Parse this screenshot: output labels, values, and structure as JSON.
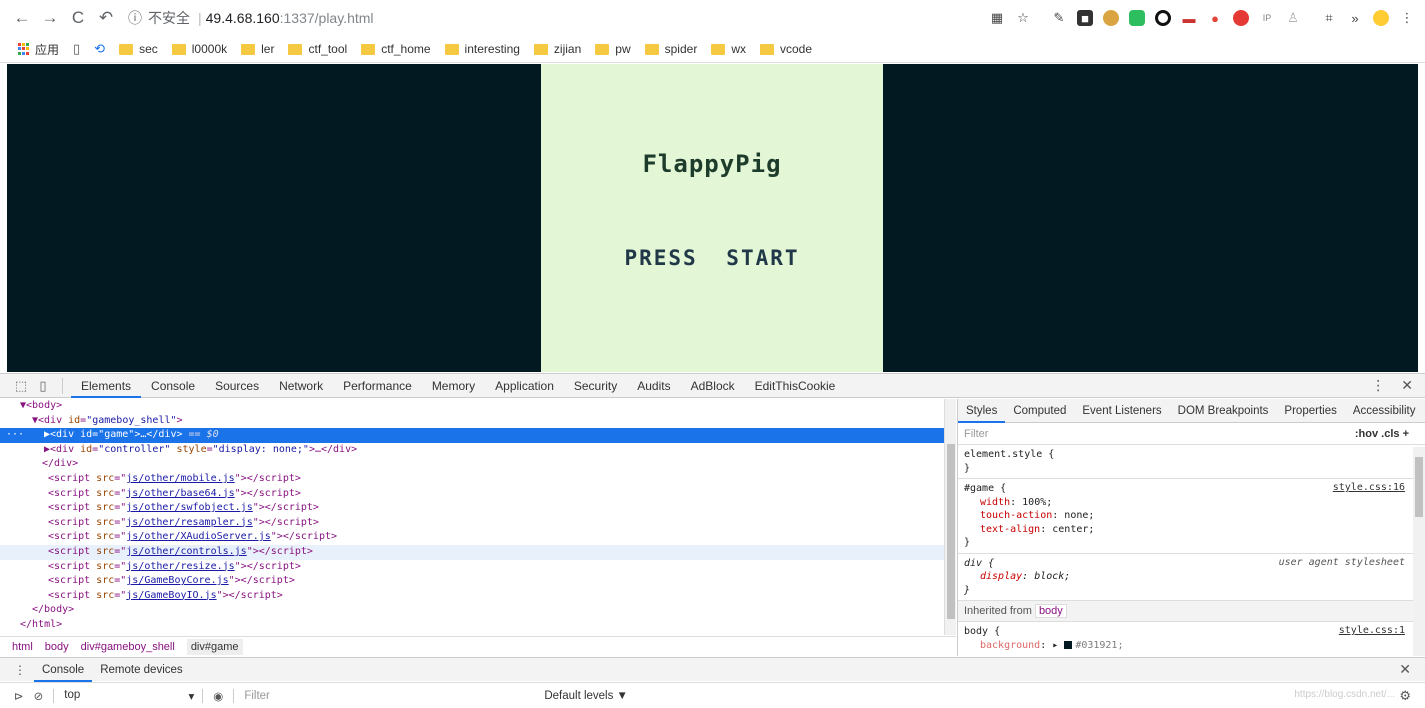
{
  "browser": {
    "url_info": "ⓘ",
    "url_insecure": "不安全",
    "url_host": "49.4.68.160",
    "url_rest": ":1337/play.html",
    "extensions": [
      "qr-code-icon",
      "star-icon",
      "feather-icon",
      "bookmark-icon",
      "cookie-icon",
      "evernote-icon",
      "circle-icon",
      "glasses-icon",
      "location-icon",
      "stop-icon",
      "ip-icon",
      "person-icon",
      "crop-icon",
      "chevron-double-icon",
      "emoji-icon",
      "more-icon"
    ]
  },
  "bookmarks": {
    "apps_label": "应用",
    "folders": [
      "sec",
      "l0000k",
      "ler",
      "ctf_tool",
      "ctf_home",
      "interesting",
      "zijian",
      "pw",
      "spider",
      "wx",
      "vcode"
    ]
  },
  "game": {
    "title": "FlappyPig",
    "press_start": "PRESS START"
  },
  "devtools": {
    "tabs": [
      "Elements",
      "Console",
      "Sources",
      "Network",
      "Performance",
      "Memory",
      "Application",
      "Security",
      "Audits",
      "AdBlock",
      "EditThisCookie"
    ],
    "active_tab": "Elements",
    "elements": {
      "body_open": "▼<body>",
      "shell_open_tag": "▼<div ",
      "shell_attr": "id",
      "shell_val": "\"gameboy_shell\"",
      "game_prefix": "▶<div ",
      "game_attr": "id",
      "game_val": "\"game\"",
      "game_suffix": ">…</div>",
      "game_eq": " == $0",
      "controller_prefix": "▶<div ",
      "controller_attr1": "id",
      "controller_val1": "\"controller\"",
      "controller_attr2": "style",
      "controller_val2": "\"display: none;\"",
      "controller_suffix": ">…</div>",
      "div_close": "</div>",
      "scripts": [
        "js/other/mobile.js",
        "js/other/base64.js",
        "js/other/swfobject.js",
        "js/other/resampler.js",
        "js/other/XAudioServer.js",
        "js/other/controls.js",
        "js/other/resize.js",
        "js/GameBoyCore.js",
        "js/GameBoyIO.js"
      ],
      "body_close": "</body>",
      "html_close": "</html>"
    },
    "breadcrumbs": [
      "html",
      "body",
      "div#gameboy_shell",
      "div#game"
    ],
    "styles": {
      "tabs": [
        "Styles",
        "Computed",
        "Event Listeners",
        "DOM Breakpoints",
        "Properties",
        "Accessibility"
      ],
      "filter_placeholder": "Filter",
      "filter_tools": ":hov  .cls  +",
      "element_style": "element.style {",
      "close_brace": "}",
      "game_selector": "#game {",
      "game_source": "style.css:16",
      "game_props": [
        {
          "name": "width",
          "value": "100%;"
        },
        {
          "name": "touch-action",
          "value": "none;"
        },
        {
          "name": "text-align",
          "value": "center;"
        }
      ],
      "div_selector": "div {",
      "div_source": "user agent stylesheet",
      "div_prop_name": "display",
      "div_prop_value": "block;",
      "inherited_label": "Inherited from",
      "inherited_from": "body",
      "body_selector": "body {",
      "body_source": "style.css:1",
      "body_prop_name": "background",
      "body_prop_value": "#031921;"
    },
    "drawer": {
      "tabs": [
        "Console",
        "Remote devices"
      ],
      "context": "top",
      "filter_placeholder": "Filter",
      "levels": "Default levels ▼",
      "watermark": "https://blog.csdn.net/..."
    }
  }
}
